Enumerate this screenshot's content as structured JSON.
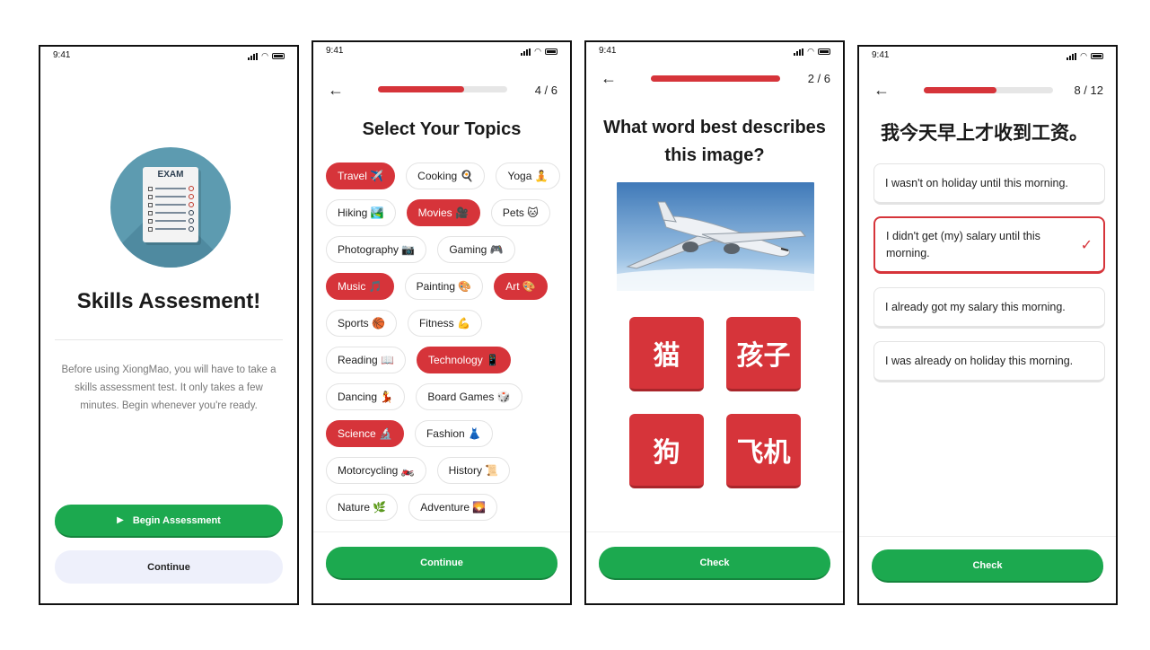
{
  "status": {
    "time": "9:41"
  },
  "screen1": {
    "exam_label": "EXAM",
    "title": "Skills Assesment!",
    "description": "Before using XiongMao, you will have to take a skills assessment test. It only takes a few minutes. Begin whenever you're ready.",
    "begin_label": "Begin Assessment",
    "continue_label": "Continue"
  },
  "screen2": {
    "counter": "4 / 6",
    "progress": 0.67,
    "title": "Select Your Topics",
    "chip_rows": [
      [
        {
          "label": "Travel ✈️",
          "selected": true
        },
        {
          "label": "Cooking 🍳",
          "selected": false
        },
        {
          "label": "Yoga 🧘",
          "selected": false
        }
      ],
      [
        {
          "label": "Hiking 🏞️",
          "selected": false
        },
        {
          "label": "Movies 🎥",
          "selected": true
        },
        {
          "label": "Pets 🐱",
          "selected": false
        }
      ],
      [
        {
          "label": "Photography 📷",
          "selected": false
        },
        {
          "label": "Gaming 🎮",
          "selected": false
        }
      ],
      [
        {
          "label": "Music 🎵",
          "selected": true
        },
        {
          "label": "Painting 🎨",
          "selected": false
        },
        {
          "label": "Art 🎨",
          "selected": true
        }
      ],
      [
        {
          "label": "Sports 🏀",
          "selected": false
        },
        {
          "label": "Fitness 💪",
          "selected": false
        }
      ],
      [
        {
          "label": "Reading 📖",
          "selected": false
        },
        {
          "label": "Technology 📱",
          "selected": true
        }
      ],
      [
        {
          "label": "Dancing 💃",
          "selected": false
        },
        {
          "label": "Board Games 🎲",
          "selected": false
        }
      ],
      [
        {
          "label": "Science 🔬",
          "selected": true
        },
        {
          "label": "Fashion 👗",
          "selected": false
        }
      ],
      [
        {
          "label": "Motorcycling 🏍️",
          "selected": false
        },
        {
          "label": "History 📜",
          "selected": false
        }
      ],
      [
        {
          "label": "Nature 🌿",
          "selected": false
        },
        {
          "label": "Adventure 🌄",
          "selected": false
        }
      ]
    ],
    "continue_label": "Continue"
  },
  "screen3": {
    "counter": "2 / 6",
    "progress": 1.0,
    "question": "What word best describes this image?",
    "tiles": [
      "猫",
      "孩子",
      "狗",
      "飞机"
    ],
    "check_label": "Check"
  },
  "screen4": {
    "counter": "8 / 12",
    "progress": 0.56,
    "sentence": "我今天早上才收到工资。",
    "options": [
      {
        "text": "I wasn't on holiday until this morning.",
        "selected": false
      },
      {
        "text": "I didn't get (my) salary until this morning.",
        "selected": true
      },
      {
        "text": "I already got my salary this morning.",
        "selected": false
      },
      {
        "text": "I was already on holiday this morning.",
        "selected": false
      }
    ],
    "check_label": "Check"
  },
  "colors": {
    "brand_red": "#d6343a",
    "brand_green": "#1ca94f",
    "light_button": "#eef0fb"
  }
}
